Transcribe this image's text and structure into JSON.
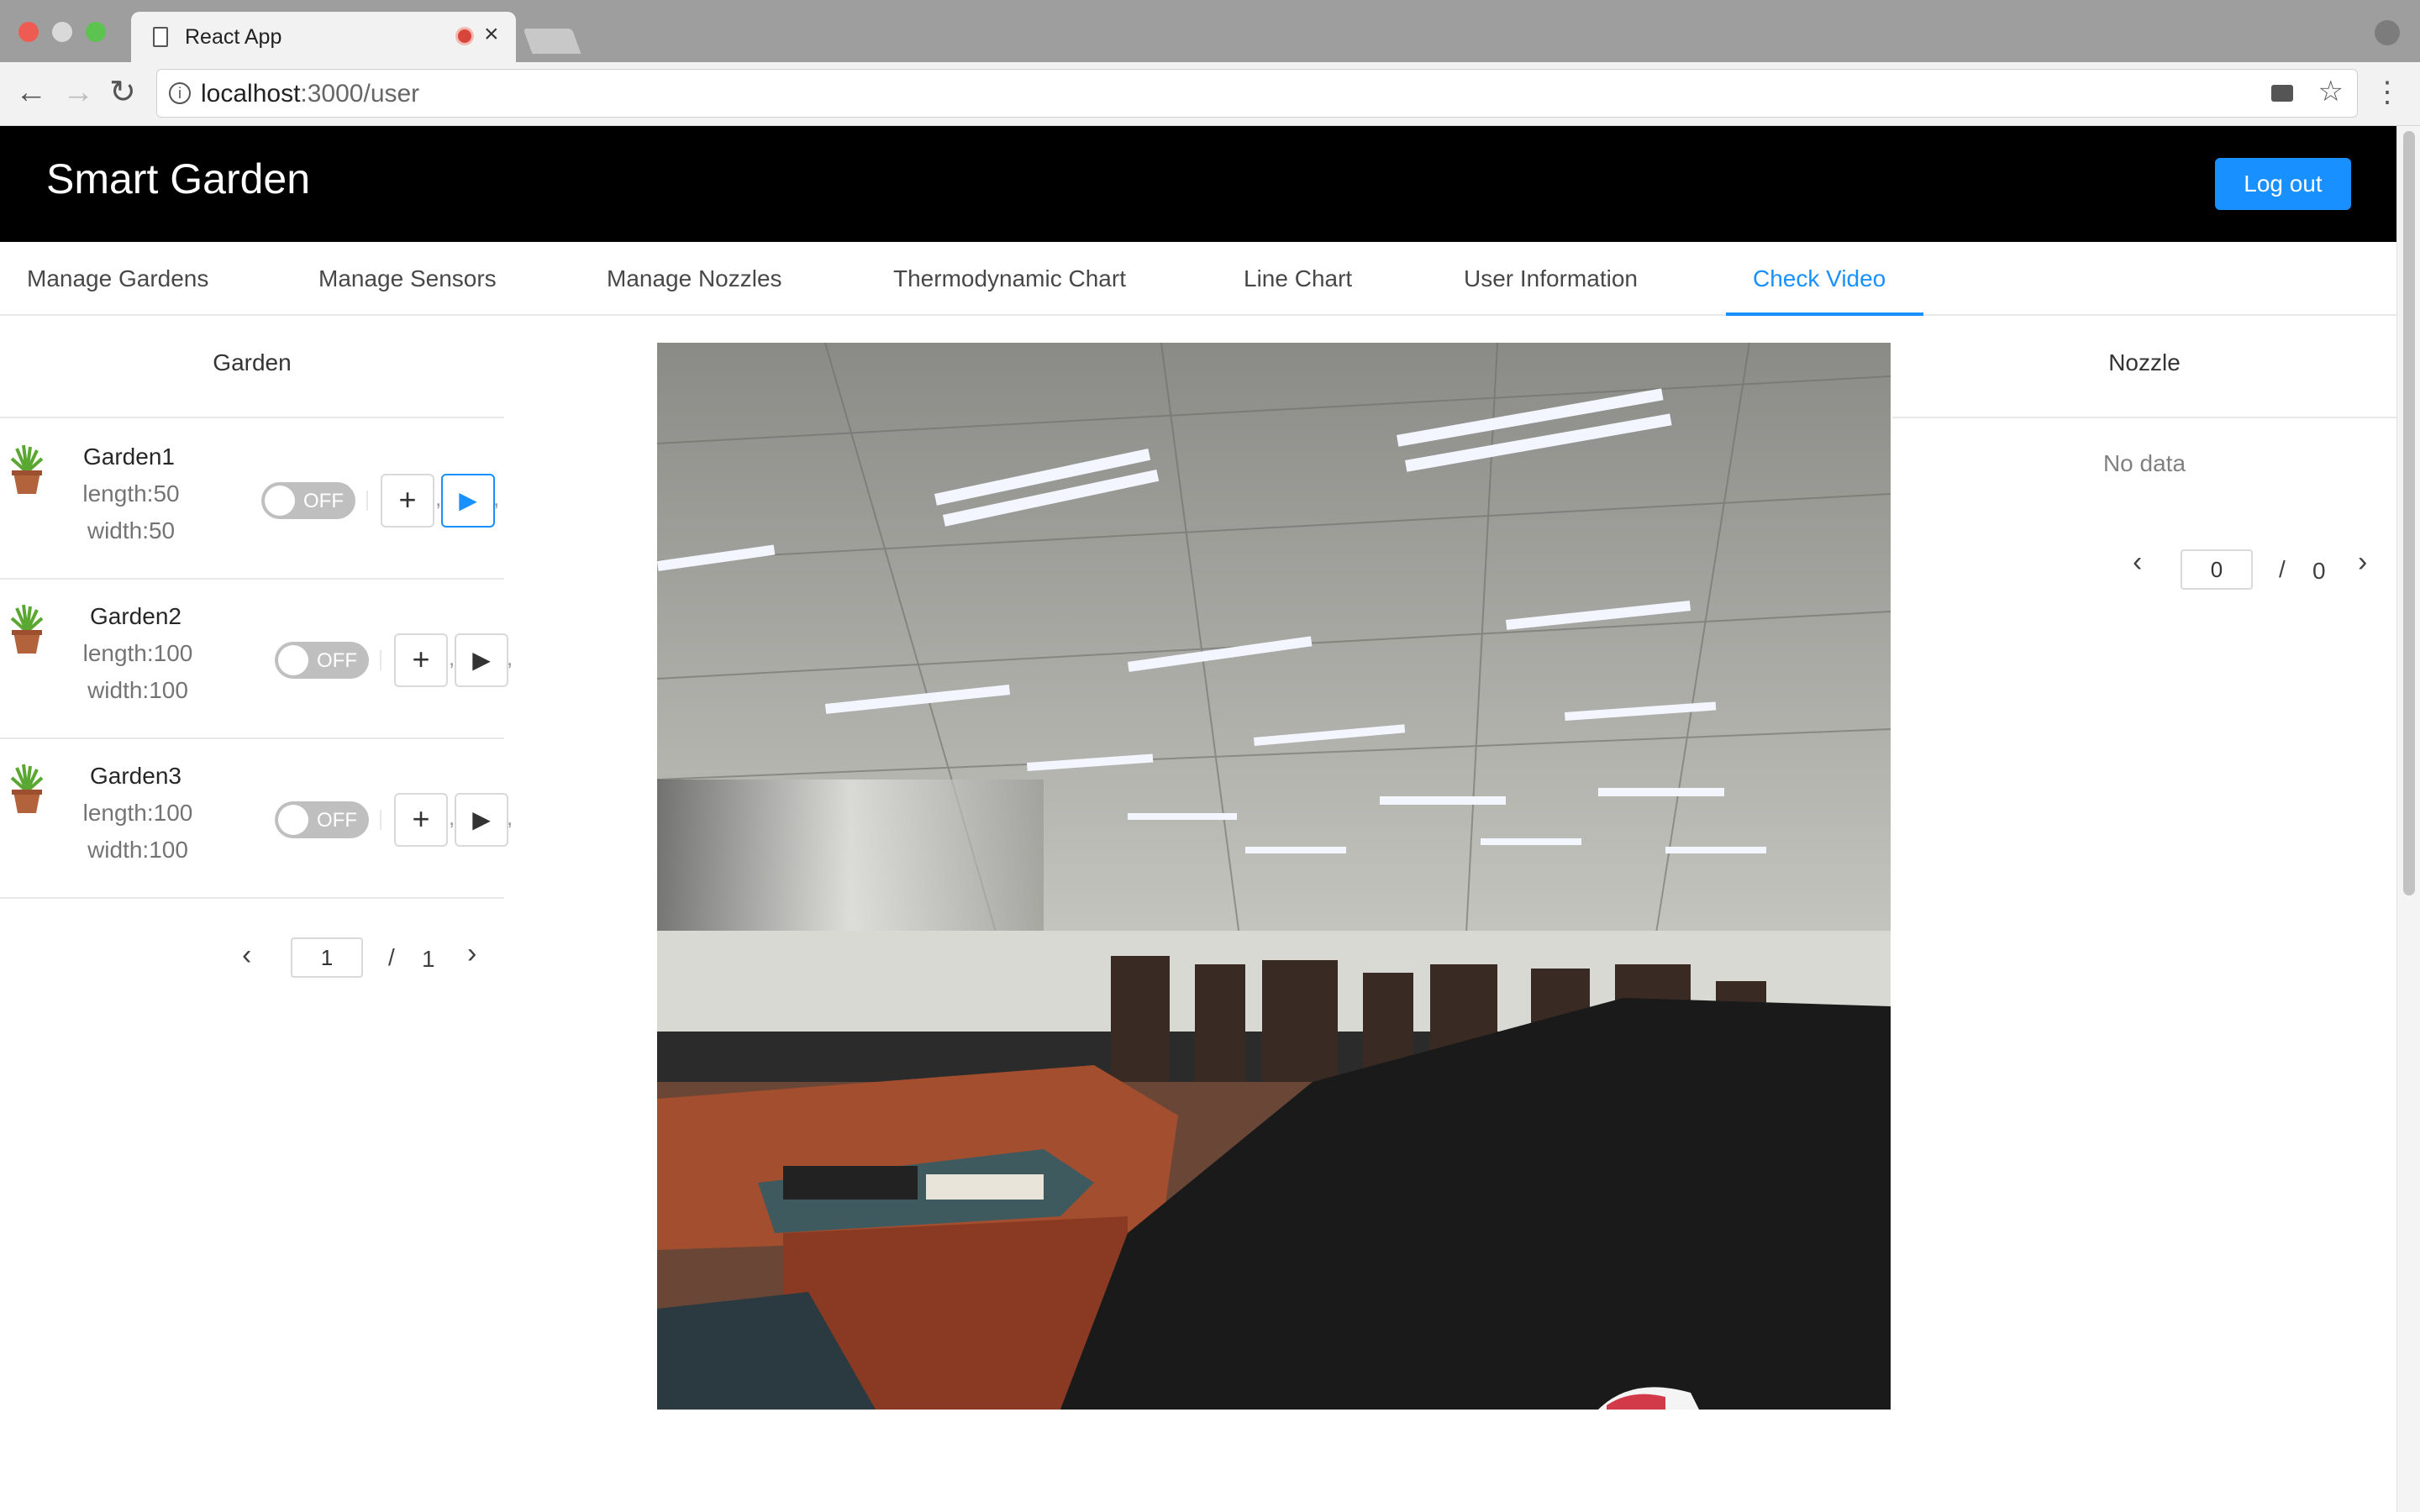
{
  "browser": {
    "tab_title": "React App",
    "url_host": "localhost",
    "url_path": ":3000/user"
  },
  "app": {
    "brand": "Smart Garden",
    "logout_label": "Log out",
    "accent_color": "#1890ff"
  },
  "menu": {
    "items": [
      {
        "label": "Manage Gardens"
      },
      {
        "label": "Manage Sensors"
      },
      {
        "label": "Manage Nozzles"
      },
      {
        "label": "Thermodynamic Chart"
      },
      {
        "label": "Line Chart"
      },
      {
        "label": "User Information"
      },
      {
        "label": "Check Video"
      }
    ],
    "active": "Check Video"
  },
  "gardens": {
    "header": "Garden",
    "rows": [
      {
        "name": "Garden1",
        "length": "length:50",
        "width": "width:50",
        "switch": "OFF"
      },
      {
        "name": "Garden2",
        "length": "length:100",
        "width": "width:100",
        "switch": "OFF"
      },
      {
        "name": "Garden3",
        "length": "length:100",
        "width": "width:100",
        "switch": "OFF"
      }
    ],
    "pagination": {
      "current": "1",
      "separator": "/",
      "total": "1"
    }
  },
  "nozzles": {
    "header": "Nozzle",
    "empty_text": "No data",
    "pagination": {
      "current": "0",
      "separator": "/",
      "total": "0"
    }
  },
  "icons": {
    "plus": "+",
    "play": "▶",
    "prev": "‹",
    "next": "›"
  }
}
